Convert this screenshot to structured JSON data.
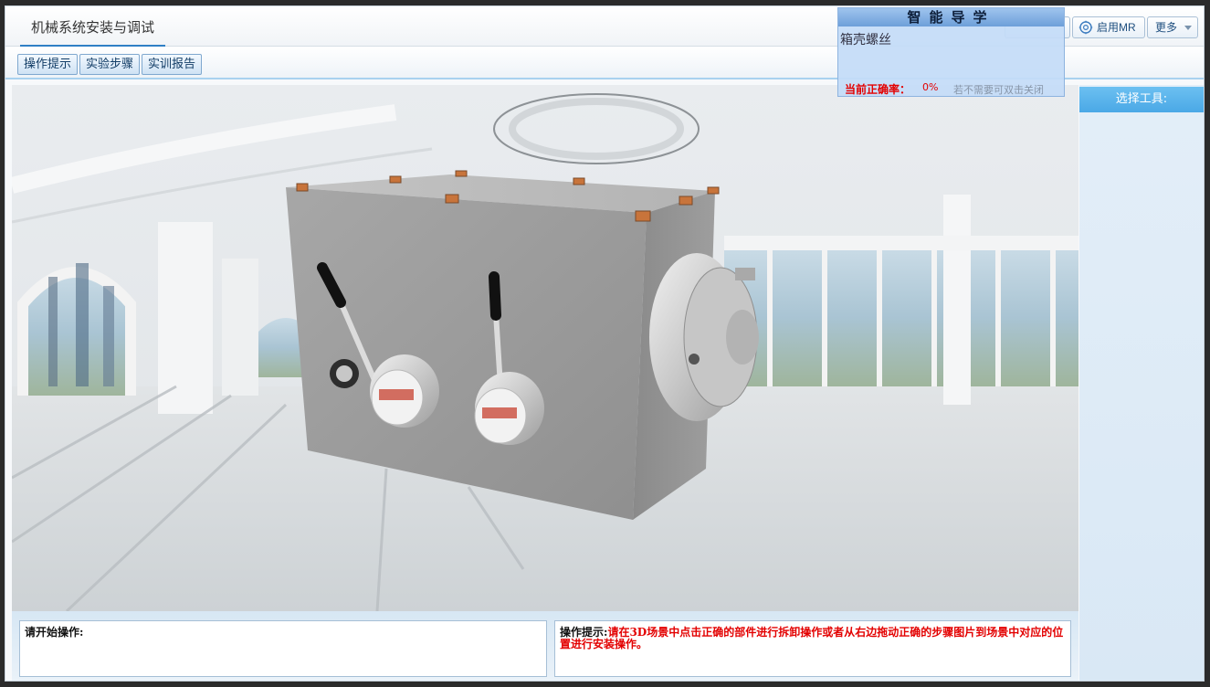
{
  "header": {
    "title": "机械系统安装与调试",
    "mr_label": "启用MR",
    "more_label": "更多"
  },
  "toolbar": {
    "tips_label": "操作提示",
    "steps_label": "实验步骤",
    "report_label": "实训报告"
  },
  "guide": {
    "title": "智能导学",
    "task": "箱壳螺丝",
    "rate_label": "当前正确率：",
    "rate_value": "0%",
    "close_hint": "若不需要可双击关闭"
  },
  "side_panel": {
    "title": "选择工具:"
  },
  "status": {
    "start_prompt": "请开始操作:",
    "hint_label": "操作提示:",
    "hint_text": "请在3D场景中点击正确的部件进行拆卸操作或者从右边拖动正确的步骤图片到场景中对应的位置进行安装操作。"
  },
  "colors": {
    "accent": "#2f7fc5",
    "side_title_bg": "#4aa8e6",
    "hint_red": "#e30000"
  },
  "icons": {
    "mr": "mr-icon",
    "more": "chevron-down-icon"
  }
}
